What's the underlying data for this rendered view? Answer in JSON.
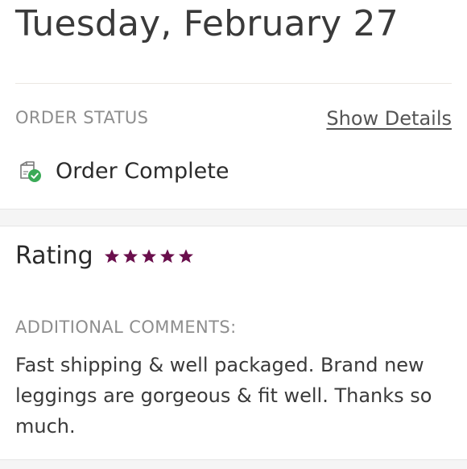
{
  "header": {
    "date": "Tuesday, February 27"
  },
  "order": {
    "status_label": "ORDER STATUS",
    "details_link": "Show Details",
    "status_icon": "package-check-icon",
    "status_text": "Order Complete",
    "status_icon_color": "#3aaa57"
  },
  "rating": {
    "label": "Rating",
    "stars": 5,
    "max_stars": 5,
    "star_color": "#6a0f4c"
  },
  "comments": {
    "label": "ADDITIONAL COMMENTS:",
    "text": "Fast shipping & well packaged. Brand new leggings are gorgeous & fit well. Thanks so much."
  }
}
